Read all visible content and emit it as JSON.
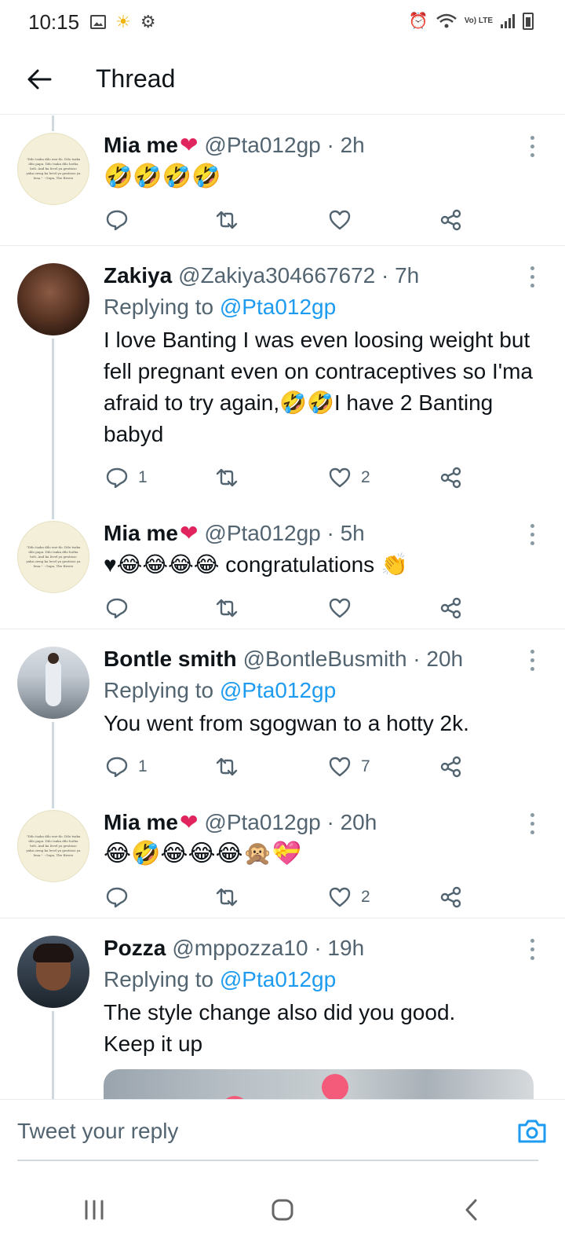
{
  "status_bar": {
    "time": "10:15",
    "network": "Vo) LTE"
  },
  "header": {
    "title": "Thread"
  },
  "tweets": [
    {
      "name": "Mia me",
      "name_emoji": "❤",
      "handle": "@Pta012gp · 2h",
      "reply_to_prefix": "",
      "reply_to": "",
      "text": "🤣🤣🤣🤣",
      "replies": "",
      "likes": ""
    },
    {
      "name": "Zakiya",
      "name_emoji": "",
      "handle": "@Zakiya304667672 · 7h",
      "reply_to_prefix": "Replying to ",
      "reply_to": "@Pta012gp",
      "text": "I love Banting I was even loosing weight but fell pregnant even on contraceptives so I'ma afraid to try again,🤣🤣I have 2 Banting babyd",
      "replies": "1",
      "likes": "2"
    },
    {
      "name": "Mia me",
      "name_emoji": "❤",
      "handle": "@Pta012gp · 5h",
      "reply_to_prefix": "",
      "reply_to": "",
      "text": "♥😂😂😂😂 congratulations 👏",
      "replies": "",
      "likes": ""
    },
    {
      "name": "Bontle smith",
      "name_emoji": "",
      "handle": "@BontleBusmith · 20h",
      "reply_to_prefix": "Replying to ",
      "reply_to": "@Pta012gp",
      "text": "You went from sgogwan to a hotty 2k.",
      "replies": "1",
      "likes": "7"
    },
    {
      "name": "Mia me",
      "name_emoji": "❤",
      "handle": "@Pta012gp · 20h",
      "reply_to_prefix": "",
      "reply_to": "",
      "text": "😂🤣😂😂😂🙊💝",
      "replies": "",
      "likes": "2"
    },
    {
      "name": "Pozza",
      "name_emoji": "",
      "handle": "@mppozza10 · 19h",
      "reply_to_prefix": "Replying to ",
      "reply_to": "@Pta012gp",
      "text": "The style change also did you good.\nKeep it up",
      "replies": "",
      "likes": ""
    }
  ],
  "avatar_quote_text": "\"Dilo tsaka dilo ene-ilo. Dilo tsaka dilo papa. Dilo tsaka dilo botha beli. And ka level ya gentioso yaka owng ka level ya gentioso ya lena.\" - Oupa, The Rivers",
  "reply_box": {
    "placeholder": "Tweet your reply"
  },
  "colors": {
    "accent": "#1d9bf0",
    "secondary_text": "#536471",
    "divider": "#e6ecf0",
    "name_heart": "#e0245e"
  }
}
